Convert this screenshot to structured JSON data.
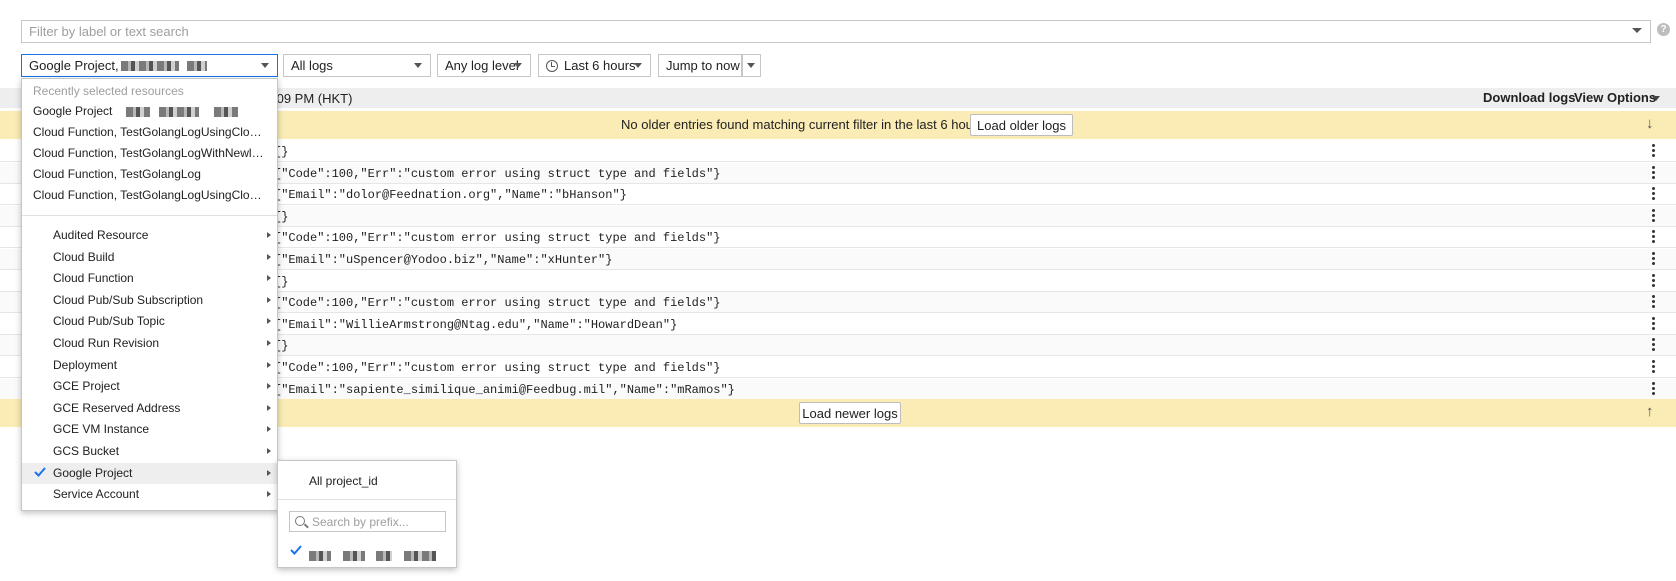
{
  "filter": {
    "placeholder": "Filter by label or text search",
    "help": "?"
  },
  "toolbar": {
    "resource_label": "Google Project,",
    "logs_label": "All logs",
    "level_label": "Any log level",
    "time_label": "Last 6 hours",
    "jump_label": "Jump to now"
  },
  "status": {
    "time_text": ":09 PM (HKT)",
    "download": "Download logs",
    "view_options": "View Options"
  },
  "banner_top": {
    "text": "No older entries found matching current filter in the last 6 hours.",
    "button": "Load older logs"
  },
  "banner_bottom": {
    "button": "Load newer logs"
  },
  "logs": [
    "{}",
    "{\"Code\":100,\"Err\":\"custom error using struct type and fields\"}",
    "{\"Email\":\"dolor@Feednation.org\",\"Name\":\"bHanson\"}",
    "{}",
    "{\"Code\":100,\"Err\":\"custom error using struct type and fields\"}",
    "{\"Email\":\"uSpencer@Yodoo.biz\",\"Name\":\"xHunter\"}",
    "{}",
    "{\"Code\":100,\"Err\":\"custom error using struct type and fields\"}",
    "{\"Email\":\"WillieArmstrong@Ntag.edu\",\"Name\":\"HowardDean\"}",
    "{}",
    "{\"Code\":100,\"Err\":\"custom error using struct type and fields\"}",
    "{\"Email\":\"sapiente_similique_animi@Feedbug.mil\",\"Name\":\"mRamos\"}"
  ],
  "resource_panel": {
    "recent_header": "Recently selected resources",
    "recent": [
      "Google Project",
      "Cloud Function, TestGolangLogUsingCloudLogging",
      "Cloud Function, TestGolangLogWithNewlines",
      "Cloud Function, TestGolangLog",
      "Cloud Function, TestGolangLogUsingCloudLoggingStruct"
    ],
    "types": [
      "Audited Resource",
      "Cloud Build",
      "Cloud Function",
      "Cloud Pub/Sub Subscription",
      "Cloud Pub/Sub Topic",
      "Cloud Run Revision",
      "Deployment",
      "GCE Project",
      "GCE Reserved Address",
      "GCE VM Instance",
      "GCS Bucket",
      "Google Project",
      "Service Account"
    ],
    "selected_type": "Google Project"
  },
  "submenu": {
    "all_label": "All project_id",
    "search_placeholder": "Search by prefix..."
  },
  "colors": {
    "accent": "#1a73e8",
    "banner": "#fbecb5"
  }
}
